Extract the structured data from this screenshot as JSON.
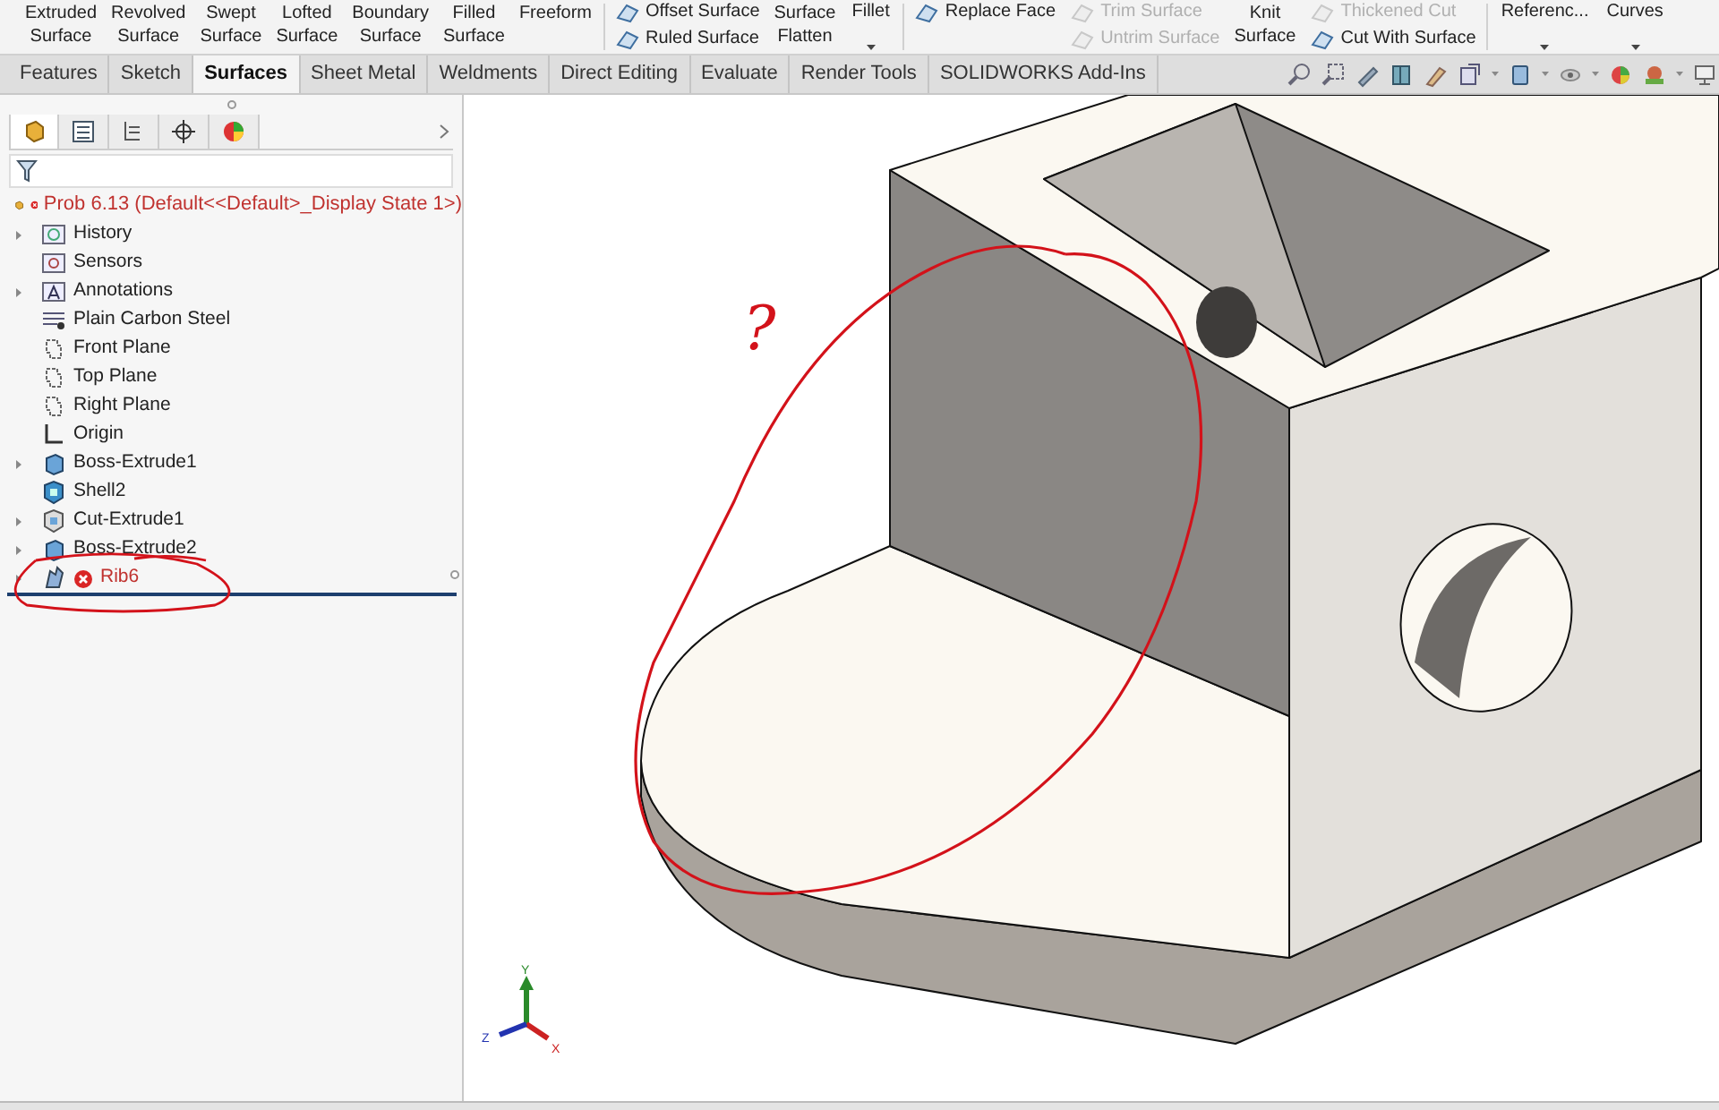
{
  "ribbon": {
    "columns": [
      {
        "kind": "large",
        "lines": [
          "Extruded",
          "Surface"
        ]
      },
      {
        "kind": "large",
        "lines": [
          "Revolved",
          "Surface"
        ]
      },
      {
        "kind": "large",
        "lines": [
          "Swept",
          "Surface"
        ]
      },
      {
        "kind": "large",
        "lines": [
          "Lofted",
          "Surface"
        ]
      },
      {
        "kind": "large",
        "lines": [
          "Boundary",
          "Surface"
        ]
      },
      {
        "kind": "large",
        "lines": [
          "Filled",
          "Surface"
        ]
      },
      {
        "kind": "large",
        "lines": [
          "Freeform"
        ]
      },
      {
        "kind": "stack",
        "items": [
          {
            "label": "Offset Surface",
            "disabled": false
          },
          {
            "label": "Ruled Surface",
            "disabled": false
          }
        ]
      },
      {
        "kind": "large",
        "lines": [
          "Surface",
          "Flatten"
        ]
      },
      {
        "kind": "dropdown",
        "lines": [
          "Fillet"
        ]
      },
      {
        "kind": "stack",
        "items": [
          {
            "label": "Replace Face",
            "disabled": false
          }
        ]
      },
      {
        "kind": "stack",
        "items": [
          {
            "label": "Trim Surface",
            "disabled": true
          },
          {
            "label": "Untrim Surface",
            "disabled": true
          }
        ]
      },
      {
        "kind": "large",
        "lines": [
          "Knit",
          "Surface"
        ]
      },
      {
        "kind": "stack",
        "items": [
          {
            "label": "Thickened Cut",
            "disabled": true
          },
          {
            "label": "Cut With Surface",
            "disabled": false
          }
        ]
      },
      {
        "kind": "dropdown",
        "lines": [
          "Referenc..."
        ]
      },
      {
        "kind": "dropdown",
        "lines": [
          "Curves"
        ]
      }
    ]
  },
  "tabs": [
    {
      "label": "Features",
      "selected": false
    },
    {
      "label": "Sketch",
      "selected": false
    },
    {
      "label": "Surfaces",
      "selected": true
    },
    {
      "label": "Sheet Metal",
      "selected": false
    },
    {
      "label": "Weldments",
      "selected": false
    },
    {
      "label": "Direct Editing",
      "selected": false
    },
    {
      "label": "Evaluate",
      "selected": false
    },
    {
      "label": "Render Tools",
      "selected": false
    },
    {
      "label": "SOLIDWORKS Add-Ins",
      "selected": false
    }
  ],
  "panel_tabs": [
    {
      "selected": true
    },
    {
      "selected": false
    },
    {
      "selected": false
    },
    {
      "selected": false
    },
    {
      "selected": false
    }
  ],
  "feature_tree": {
    "root": {
      "label": "Prob 6.13  (Default<<Default>_Display State 1>)",
      "error": true
    },
    "items": [
      {
        "label": "History",
        "kind": "folder",
        "expandable": true,
        "error": false
      },
      {
        "label": "Sensors",
        "kind": "sensor",
        "expandable": false,
        "error": false
      },
      {
        "label": "Annotations",
        "kind": "annotation",
        "expandable": true,
        "error": false
      },
      {
        "label": "Plain Carbon Steel",
        "kind": "material",
        "expandable": false,
        "error": false
      },
      {
        "label": "Front Plane",
        "kind": "plane",
        "expandable": false,
        "error": false
      },
      {
        "label": "Top Plane",
        "kind": "plane",
        "expandable": false,
        "error": false
      },
      {
        "label": "Right Plane",
        "kind": "plane",
        "expandable": false,
        "error": false
      },
      {
        "label": "Origin",
        "kind": "origin",
        "expandable": false,
        "error": false
      },
      {
        "label": "Boss-Extrude1",
        "kind": "extrude",
        "expandable": true,
        "error": false
      },
      {
        "label": "Shell2",
        "kind": "shell",
        "expandable": false,
        "error": false
      },
      {
        "label": "Cut-Extrude1",
        "kind": "cut",
        "expandable": true,
        "error": false
      },
      {
        "label": "Boss-Extrude2",
        "kind": "extrude",
        "expandable": true,
        "error": false
      },
      {
        "label": "Rib6",
        "kind": "rib",
        "expandable": true,
        "error": true
      }
    ]
  },
  "viewport": {
    "annotation_text": "?",
    "triad": {
      "y": "Y",
      "z": "Z",
      "x": "X"
    }
  }
}
